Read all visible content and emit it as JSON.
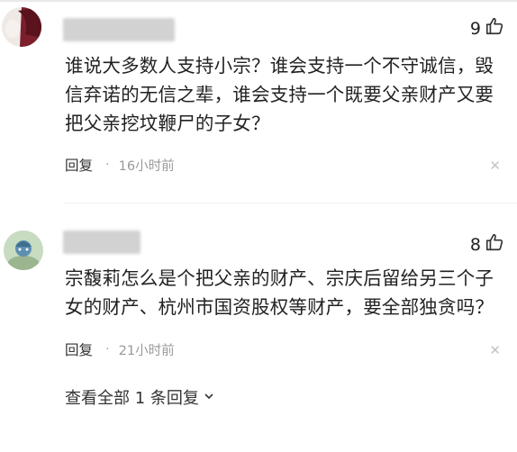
{
  "comments": [
    {
      "likes": "9",
      "text": "谁说大多数人支持小宗？谁会支持一个不守诚信，毁信弃诺的无信之辈，谁会支持一个既要父亲财产又要把父亲挖坟鞭尸的子女？",
      "reply_label": "回复",
      "separator": "·",
      "time": "16小时前",
      "close_glyph": "✕"
    },
    {
      "likes": "8",
      "text": "宗馥莉怎么是个把父亲的财产、宗庆后留给另三个子女的财产、杭州市国资股权等财产，要全部独贪吗？",
      "reply_label": "回复",
      "separator": "·",
      "time": "21小时前",
      "close_glyph": "✕"
    }
  ],
  "view_all_replies": "查看全部 1 条回复",
  "icons": {
    "like": "thumbs-up-icon",
    "expand": "chevron-down-icon",
    "close": "close-icon"
  }
}
